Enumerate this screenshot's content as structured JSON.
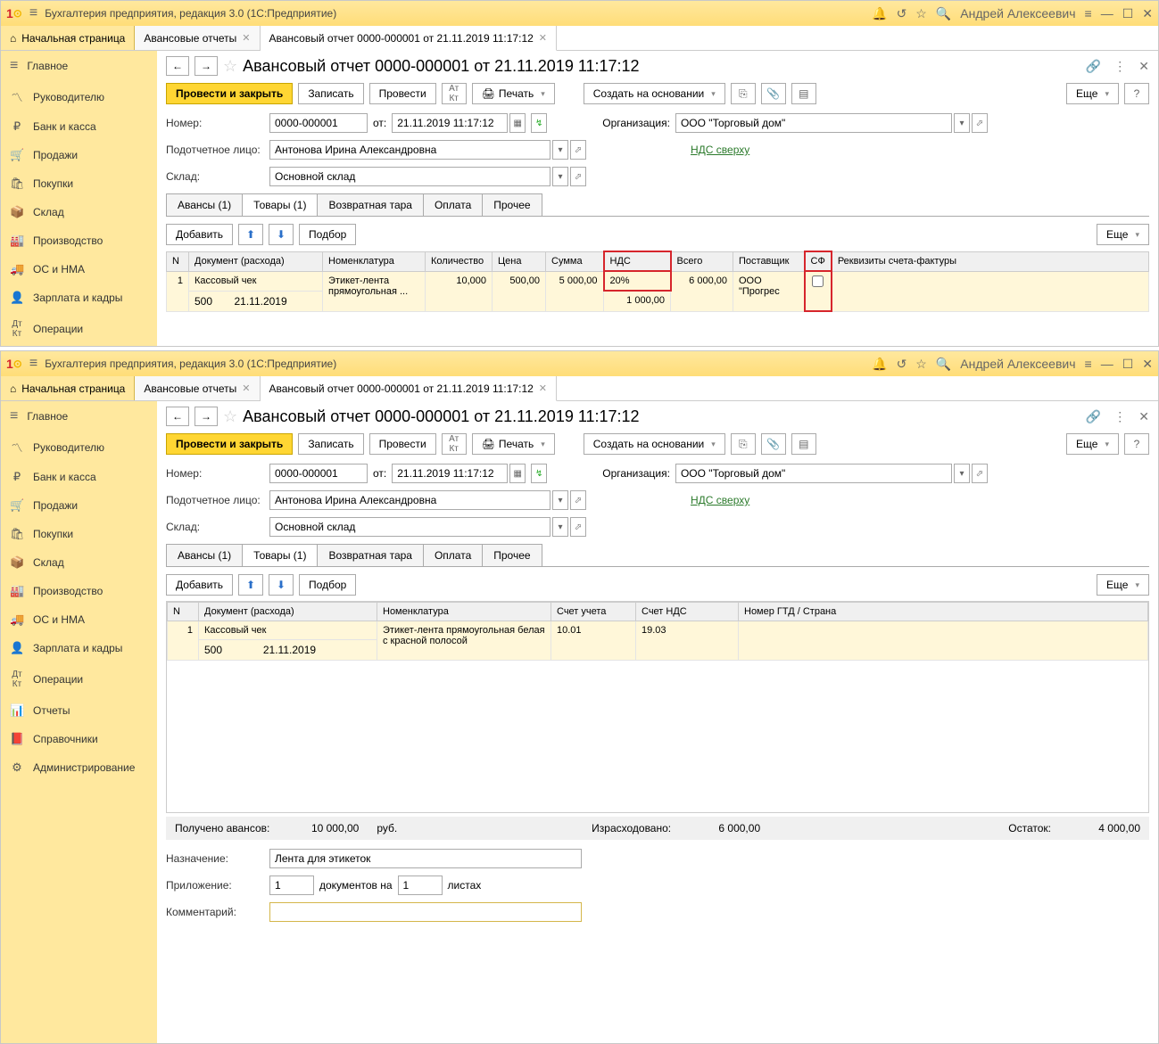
{
  "app": {
    "title": "Бухгалтерия предприятия, редакция 3.0  (1С:Предприятие)",
    "user": "Андрей Алексеевич"
  },
  "tabs": {
    "home": "Начальная страница",
    "t1": "Авансовые отчеты",
    "t2": "Авансовый отчет 0000-000001 от 21.11.2019 11:17:12"
  },
  "sidebar": {
    "main": "Главное",
    "manager": "Руководителю",
    "bank": "Банк и касса",
    "sales": "Продажи",
    "purchases": "Покупки",
    "warehouse": "Склад",
    "production": "Производство",
    "assets": "ОС и НМА",
    "salary": "Зарплата и кадры",
    "operations": "Операции",
    "reports": "Отчеты",
    "refs": "Справочники",
    "admin": "Администрирование"
  },
  "doc": {
    "title": "Авансовый отчет 0000-000001 от 21.11.2019 11:17:12",
    "post_close": "Провести и закрыть",
    "record": "Записать",
    "post": "Провести",
    "print": "Печать",
    "create_based": "Создать на основании",
    "more": "Еще",
    "number_label": "Номер:",
    "number": "0000-000001",
    "from": "от:",
    "date": "21.11.2019 11:17:12",
    "org_label": "Организация:",
    "org": "ООО \"Торговый дом\"",
    "person_label": "Подотчетное лицо:",
    "person": "Антонова Ирина Александровна",
    "vat_link": "НДС сверху",
    "wh_label": "Склад:",
    "wh": "Основной склад"
  },
  "dtabs": {
    "advances": "Авансы (1)",
    "goods": "Товары (1)",
    "tare": "Возвратная тара",
    "payment": "Оплата",
    "other": "Прочее"
  },
  "subtb": {
    "add": "Добавить",
    "select": "Подбор",
    "more": "Еще"
  },
  "table1": {
    "h": {
      "n": "N",
      "doc": "Документ (расхода)",
      "nom": "Номенклатура",
      "qty": "Количество",
      "price": "Цена",
      "sum": "Сумма",
      "vat": "НДС",
      "total": "Всего",
      "supplier": "Поставщик",
      "sf": "СФ",
      "sf_req": "Реквизиты счета-фактуры"
    },
    "r": {
      "n": "1",
      "doc1": "Кассовый чек",
      "doc2": "500",
      "doc3": "21.11.2019",
      "nom": "Этикет-лента прямоугольная ...",
      "qty": "10,000",
      "price": "500,00",
      "sum": "5 000,00",
      "vat": "20%",
      "vat2": "1 000,00",
      "total": "6 000,00",
      "supplier": "ООО \"Прогрес"
    }
  },
  "table2": {
    "h": {
      "n": "N",
      "doc": "Документ (расхода)",
      "nom": "Номенклатура",
      "acc": "Счет учета",
      "vat_acc": "Счет НДС",
      "gtd": "Номер ГТД / Страна"
    },
    "r": {
      "n": "1",
      "doc1": "Кассовый чек",
      "doc2": "500",
      "doc3": "21.11.2019",
      "nom": "Этикет-лента прямоугольная белая с красной полосой",
      "acc": "10.01",
      "vat_acc": "19.03"
    }
  },
  "summary": {
    "adv_label": "Получено авансов:",
    "adv": "10 000,00",
    "cur": "руб.",
    "spent_label": "Израсходовано:",
    "spent": "6 000,00",
    "rest_label": "Остаток:",
    "rest": "4 000,00"
  },
  "footer": {
    "purpose_label": "Назначение:",
    "purpose": "Лента для этикеток",
    "att_label": "Приложение:",
    "att1": "1",
    "docs_on": "документов на",
    "att2": "1",
    "sheets": "листах",
    "comment_label": "Комментарий:",
    "comment": ""
  }
}
